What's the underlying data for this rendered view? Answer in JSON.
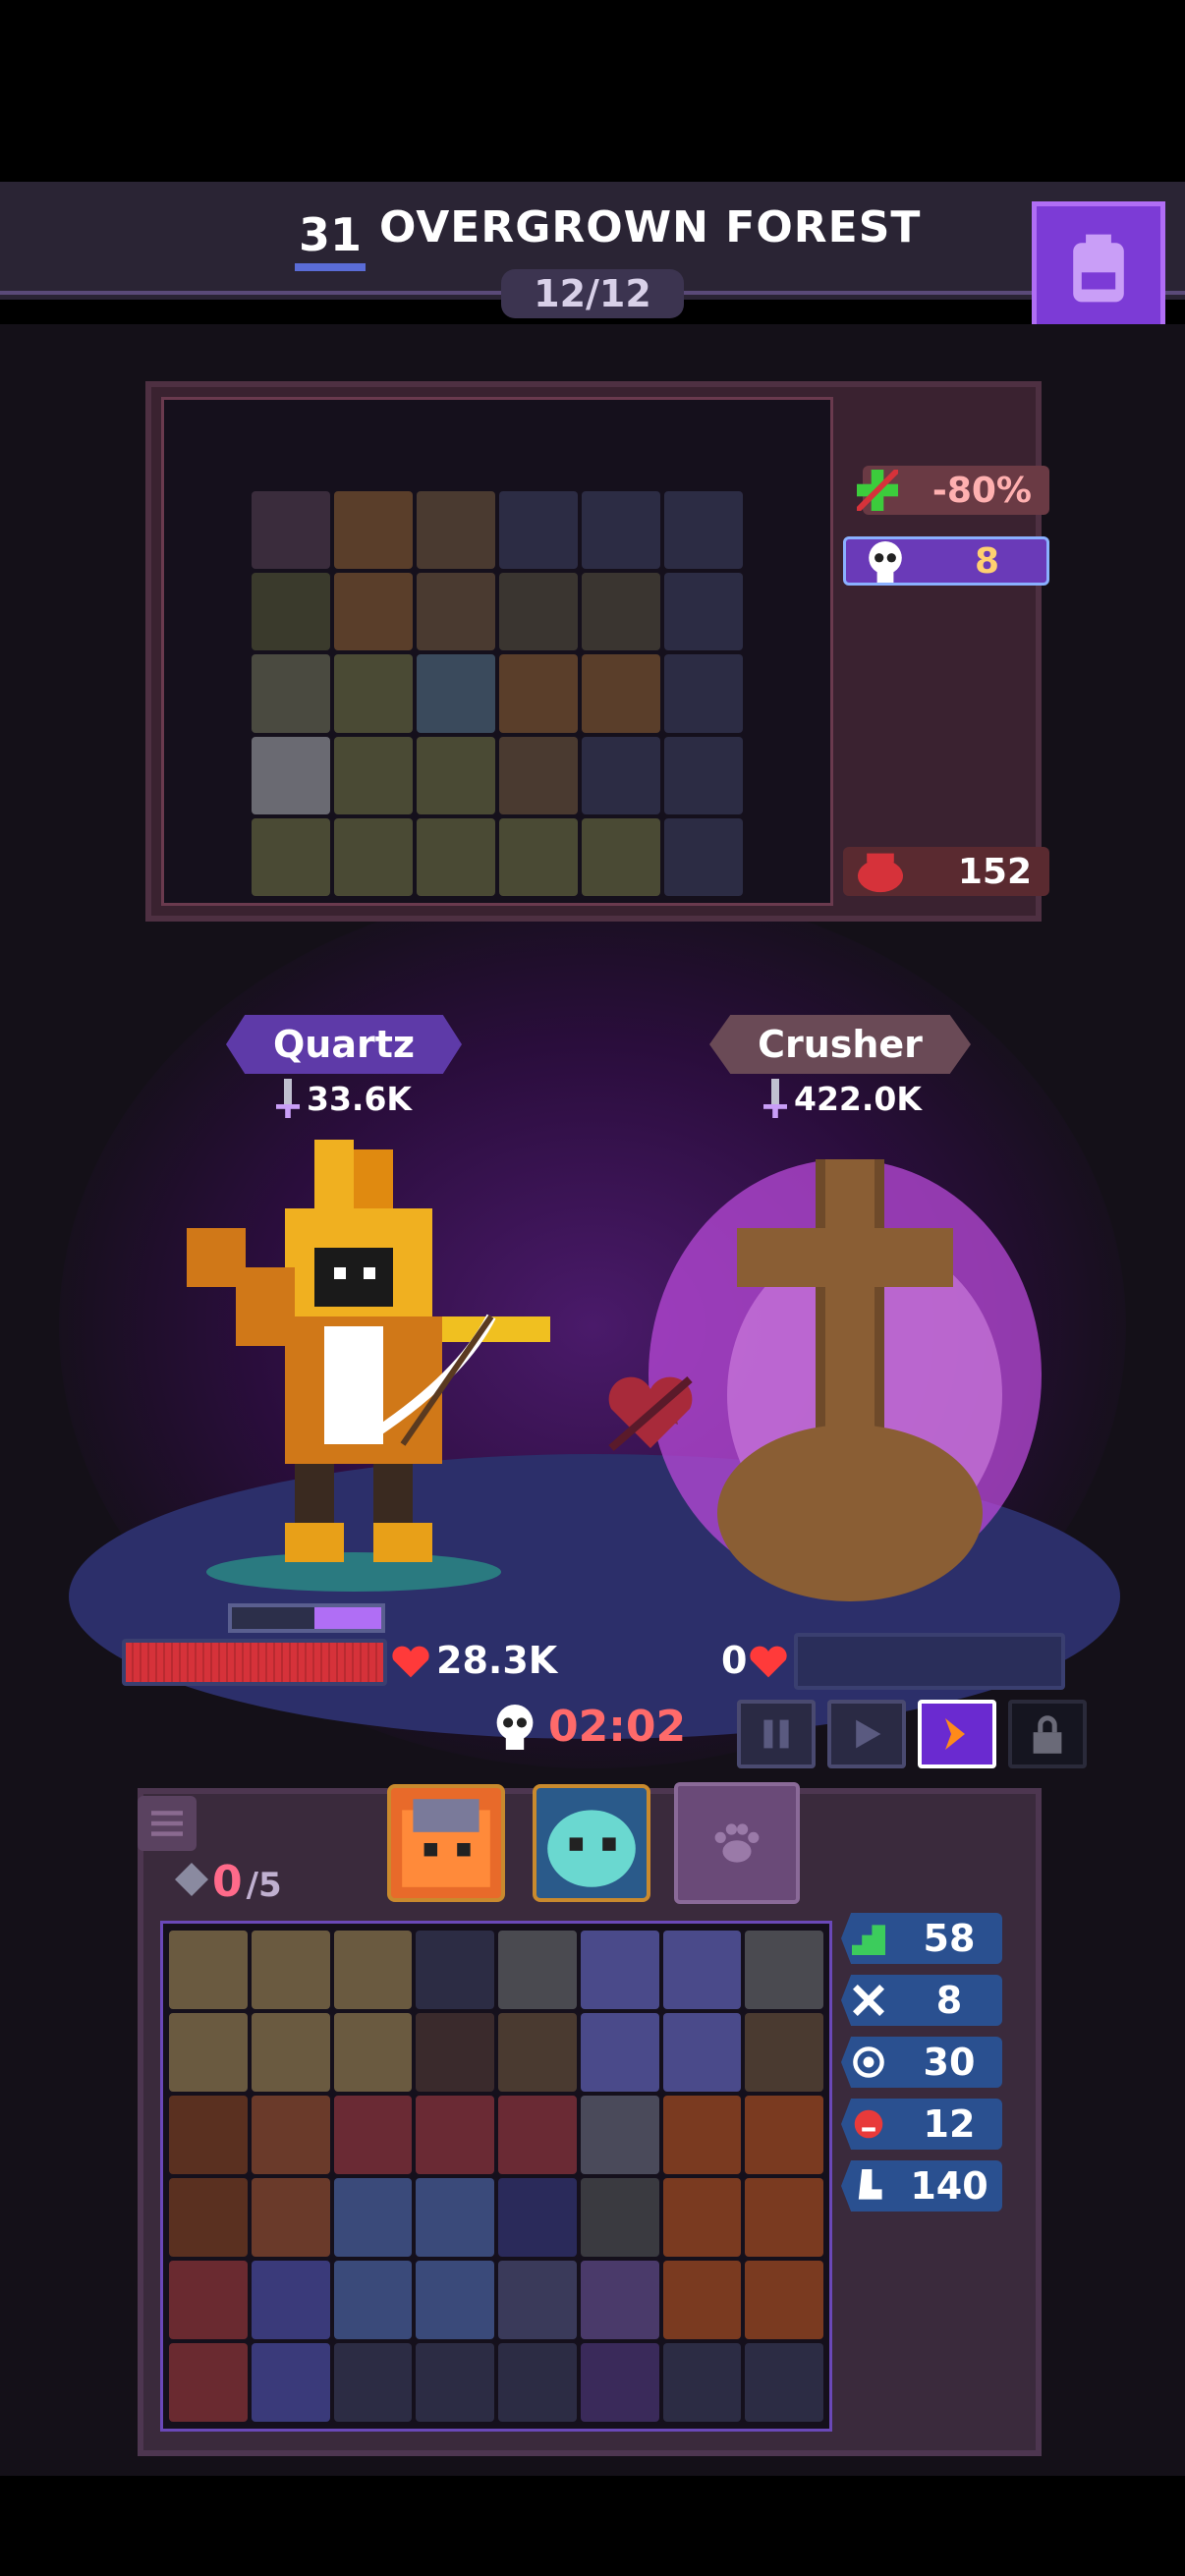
{
  "header": {
    "level": "31",
    "title": "OVERGROWN FOREST",
    "wave": "12/12"
  },
  "stash": {
    "modifiers": [
      {
        "icon": "heal-cross-icon",
        "value": "-80%"
      },
      {
        "icon": "skull-icon",
        "value": "8"
      }
    ],
    "gold": {
      "icon": "cauldron-icon",
      "value": "152"
    }
  },
  "battle": {
    "hero": {
      "name": "Quartz",
      "power": "33.6K",
      "hp": "28.3K",
      "hp_fraction": 1.0,
      "energy_fraction": 0.45
    },
    "enemy": {
      "name": "Crusher",
      "power": "422.0K",
      "hp": "0",
      "hp_fraction": 0.0
    },
    "timer": "02:02",
    "controls": [
      "pause-icon",
      "play-icon",
      "fast-forward-icon",
      "lock-icon"
    ]
  },
  "inventory": {
    "slots_label": "0",
    "slots_max": "/5",
    "stats": [
      {
        "icon": "stairs-icon",
        "value": "58"
      },
      {
        "icon": "crossed-swords-icon",
        "value": "8"
      },
      {
        "icon": "target-icon",
        "value": "30"
      },
      {
        "icon": "demon-face-icon",
        "value": "12"
      },
      {
        "icon": "boot-icon",
        "value": "140"
      }
    ]
  },
  "colors": {
    "accent_purple": "#7c3bd6",
    "hp_red": "#d6323a",
    "stat_blue": "#2a5090",
    "timer_red": "#ff6a6a"
  }
}
